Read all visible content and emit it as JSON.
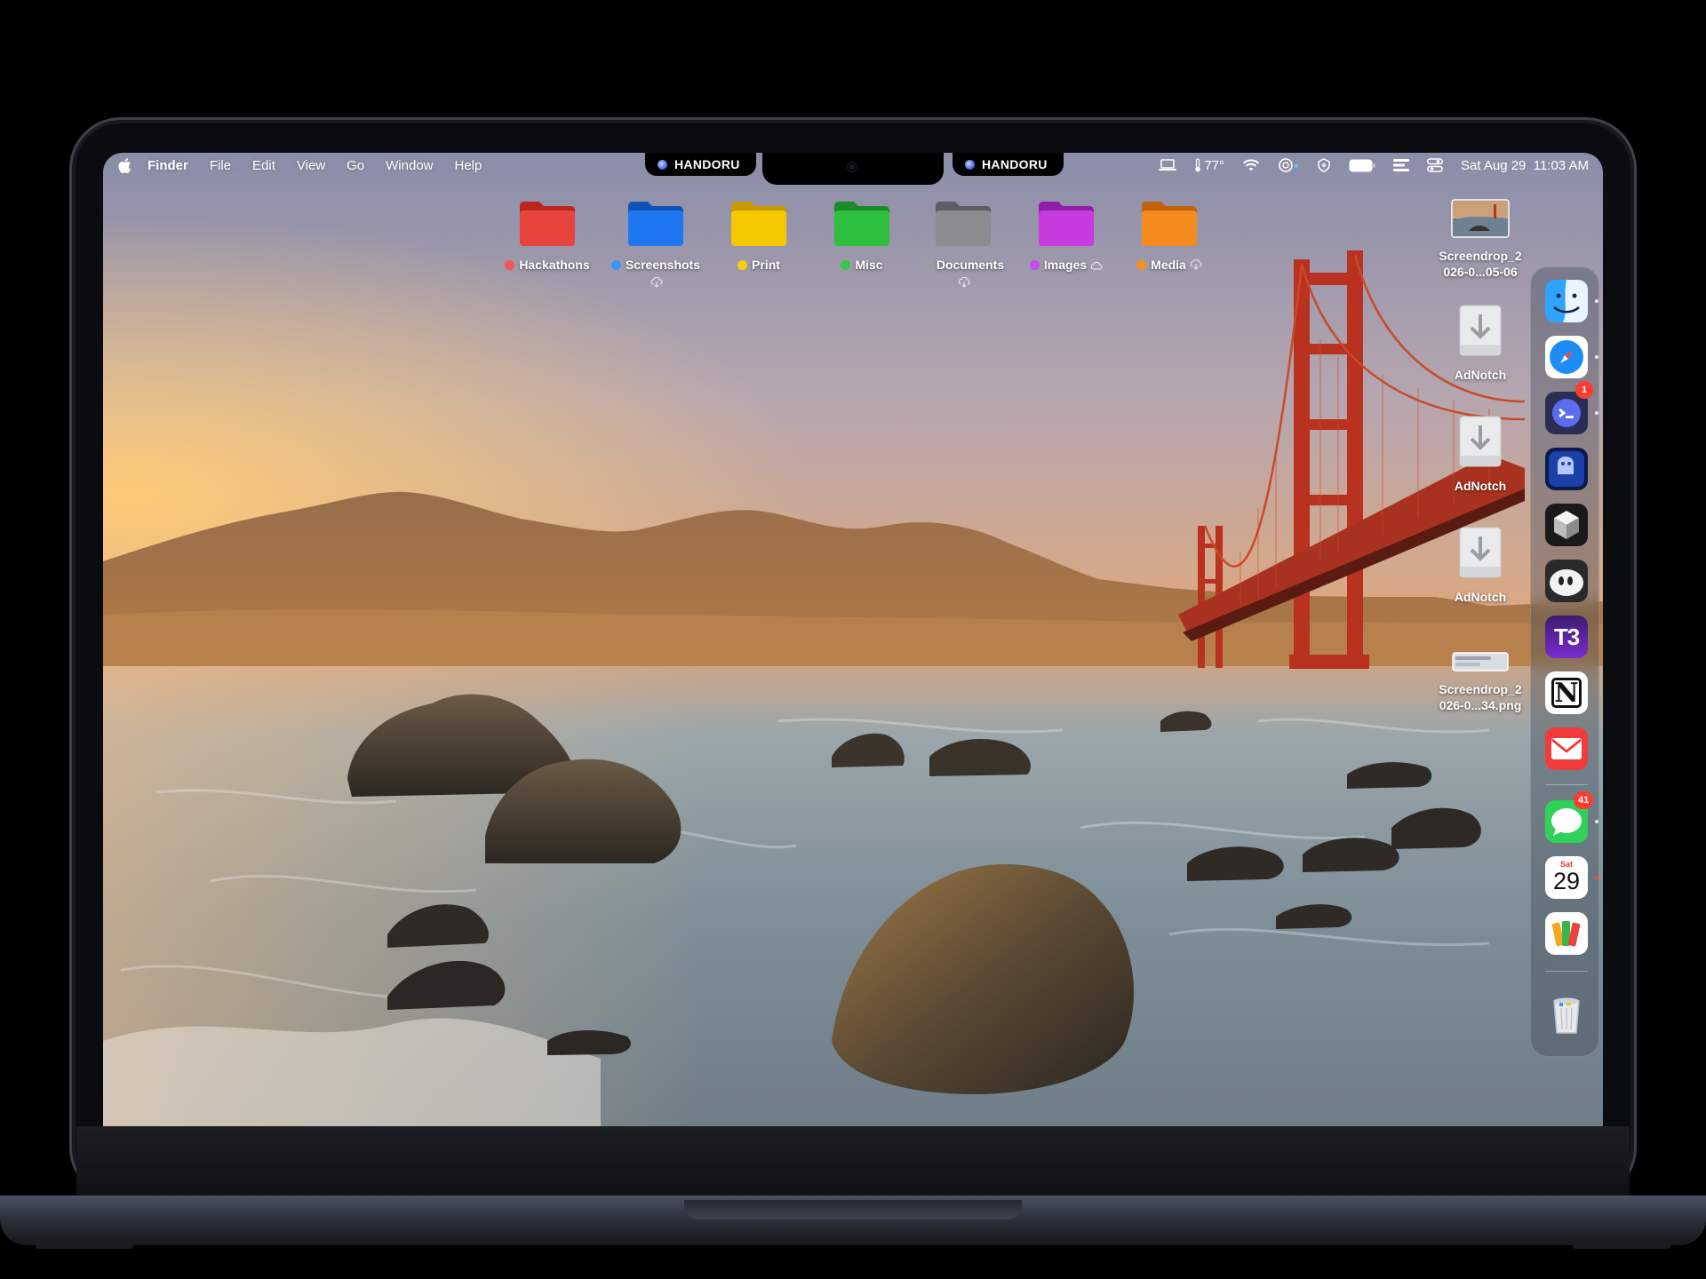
{
  "menubar": {
    "app_name": "Finder",
    "menus": [
      "File",
      "Edit",
      "View",
      "Go",
      "Window",
      "Help"
    ],
    "handoru_left": "HANDORU",
    "handoru_right": "HANDORU",
    "temperature": "77°",
    "datetime": "Sat Aug 29  11:03 AM"
  },
  "folders": [
    {
      "label": "Hackathons",
      "color": "#e8443e",
      "tag_color": "#f2575a",
      "cloud": false
    },
    {
      "label": "Screenshots",
      "color": "#1e77f0",
      "tag_color": "#3b95ff",
      "cloud": "below"
    },
    {
      "label": "Print",
      "color": "#f5c800",
      "tag_color": "#f5d000",
      "cloud": false
    },
    {
      "label": "Misc",
      "color": "#2fbf3f",
      "tag_color": "#37c84a",
      "cloud": false
    },
    {
      "label": "Documents",
      "color": "#8c8c8e",
      "tag_color": "#9c9ca0",
      "cloud": "below"
    },
    {
      "label": "Images",
      "color": "#c63ae0",
      "tag_color": "#c24ee8",
      "cloud": "inline"
    },
    {
      "label": "Media",
      "color": "#f58a1f",
      "tag_color": "#f5901e",
      "cloud": "inline"
    }
  ],
  "desktop_files": [
    {
      "name_line1": "Screendrop_2",
      "name_line2": "026-0...05-06",
      "kind": "image"
    },
    {
      "name_line1": "AdNotch",
      "name_line2": "",
      "kind": "installer"
    },
    {
      "name_line1": "AdNotch",
      "name_line2": "",
      "kind": "installer"
    },
    {
      "name_line1": "AdNotch",
      "name_line2": "",
      "kind": "installer"
    },
    {
      "name_line1": "Screendrop_2",
      "name_line2": "026-0...34.png",
      "kind": "image-wide"
    }
  ],
  "dock": {
    "apps": [
      {
        "name": "finder-icon",
        "running": true
      },
      {
        "name": "safari-icon",
        "running": true
      },
      {
        "name": "app-chat-icon",
        "running": true,
        "badge": "1"
      },
      {
        "name": "app-ghost-icon",
        "running": false
      },
      {
        "name": "app-cube-icon",
        "running": false
      },
      {
        "name": "app-pill-icon",
        "running": false
      },
      {
        "name": "t3-icon",
        "running": false,
        "label": "T3"
      },
      {
        "name": "notion-icon",
        "running": false,
        "label": "N"
      },
      {
        "name": "mail-icon",
        "running": false
      },
      {
        "name": "messages-icon",
        "running": true,
        "badge": "41"
      },
      {
        "name": "calendar-icon",
        "running": true,
        "day": "29",
        "weekday": "Sat"
      },
      {
        "name": "books-icon",
        "running": false
      },
      {
        "name": "trash-icon",
        "running": false
      }
    ]
  },
  "colors": {
    "sky_top": "#8e8faa",
    "sky_mid": "#d6a27a",
    "horizon": "#f3a860",
    "bridge": "#b8321f",
    "water": "#8a9aa3"
  }
}
